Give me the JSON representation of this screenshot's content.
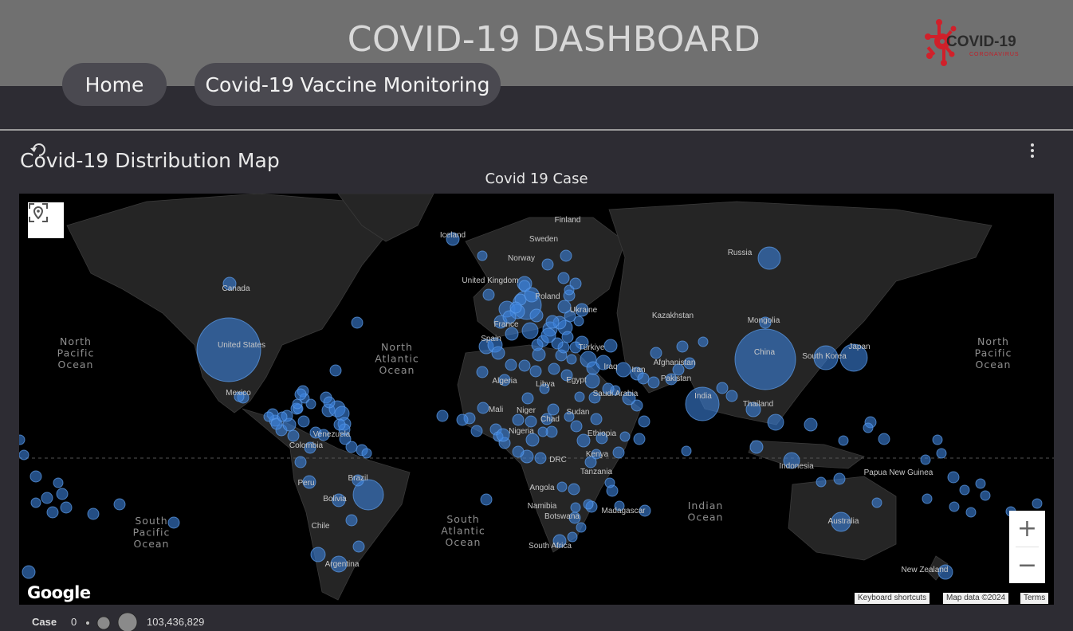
{
  "header": {
    "title": "COVID-19 DASHBOARD",
    "logo_text": "COVID-19",
    "logo_subtext": "CORONAVIRUS",
    "logo_color": "#d0202a"
  },
  "nav": {
    "home_label": "Home",
    "vaccine_label": "Covid-19 Vaccine Monitoring"
  },
  "panel": {
    "title": "Covid-19 Distribution Map",
    "chart_title": "Covid 19 Case"
  },
  "map": {
    "bubble_color": "#3c82dc",
    "country_labels": [
      "Finland",
      "Iceland",
      "Sweden",
      "Norway",
      "Russia",
      "United Kingdom",
      "Poland",
      "Canada",
      "Ukraine",
      "France",
      "Kazakhstan",
      "Mongolia",
      "Spain",
      "Türkiye",
      "United States",
      "China",
      "Japan",
      "South Korea",
      "Iraq",
      "Iran",
      "Afghanistan",
      "Algeria",
      "Libya",
      "Egypt",
      "Pakistan",
      "Saudi Arabia",
      "Mexico",
      "India",
      "Mali",
      "Niger",
      "Sudan",
      "Thailand",
      "Chad",
      "Venezuela",
      "Nigeria",
      "Ethiopia",
      "Colombia",
      "Kenya",
      "DRC",
      "Indonesia",
      "Papua New Guinea",
      "Tanzania",
      "Peru",
      "Brazil",
      "Angola",
      "Bolivia",
      "Namibia",
      "Madagascar",
      "Botswana",
      "Australia",
      "Chile",
      "South Africa",
      "Argentina",
      "New Zealand"
    ],
    "ocean_labels": [
      "North Pacific Ocean",
      "North Atlantic Ocean",
      "North Pacific Ocean",
      "South Pacific Ocean",
      "South Atlantic Ocean",
      "Indian Ocean"
    ],
    "zoom_in": "+",
    "zoom_out": "−",
    "google_logo": "Google",
    "attribution": {
      "shortcuts": "Keyboard shortcuts",
      "map_data": "Map data ©2024",
      "terms": "Terms"
    }
  },
  "legend": {
    "label": "Case",
    "min": "0",
    "max": "103,436,829"
  }
}
